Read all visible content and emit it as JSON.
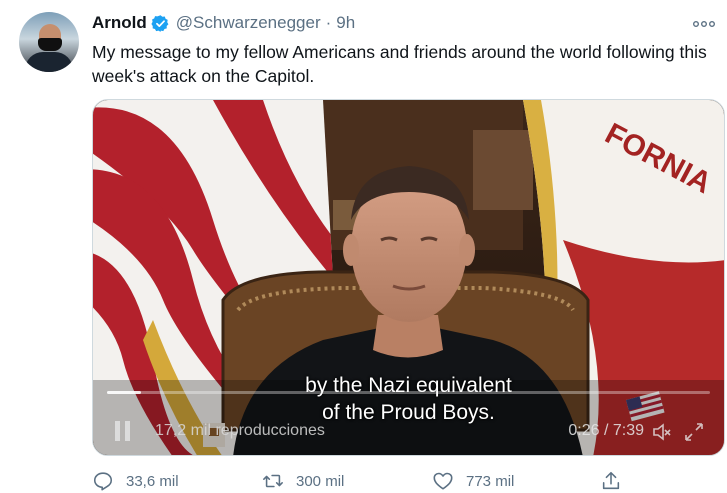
{
  "author": {
    "name": "Arnold",
    "handle": "@Schwarzenegger",
    "separator": "·",
    "time": "9h"
  },
  "tweet": {
    "text": "My message to my fellow Americans and friends around the world following this week's attack on the Capitol."
  },
  "video": {
    "subtitle_line1": "by the Nazi equivalent",
    "subtitle_line2": "of the Proud Boys.",
    "views": "17,2 mil reproducciones",
    "elapsed": "0:26 / 7:39",
    "progress": 0.057
  },
  "actions": {
    "reply_count": "33,6 mil",
    "retweet_count": "300 mil",
    "like_count": "773 mil"
  },
  "icons": {
    "verified": "verified-badge-icon",
    "more": "more-icon",
    "reply": "reply-icon",
    "retweet": "retweet-icon",
    "like": "heart-icon",
    "share": "share-icon",
    "pause": "pause-icon",
    "volume": "volume-icon",
    "fullscreen": "fullscreen-icon"
  },
  "colors": {
    "accent": "#1da1f2",
    "secondary_text": "#5b7083",
    "primary_text": "#0f1419"
  }
}
